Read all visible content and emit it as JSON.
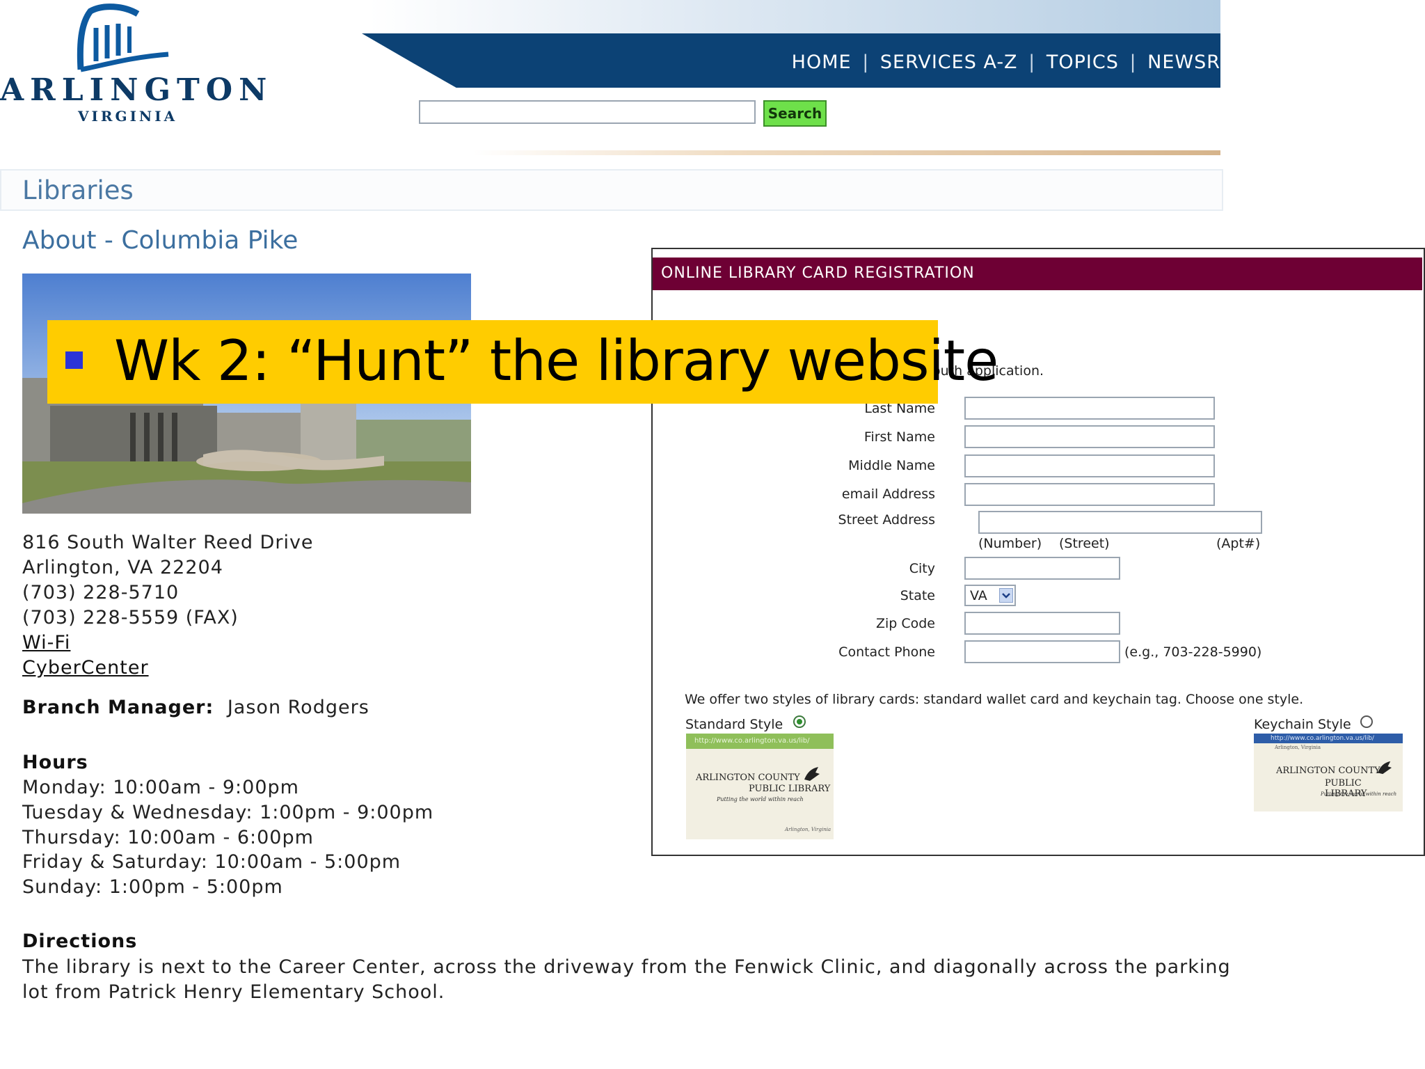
{
  "logo": {
    "name": "ARLINGTON",
    "subtitle": "VIRGINIA"
  },
  "nav": {
    "home": "HOME",
    "services": "SERVICES A-Z",
    "topics": "TOPICS",
    "news": "NEWSR",
    "separator": "|"
  },
  "search": {
    "value": "",
    "button": "Search"
  },
  "section": {
    "title": "Libraries"
  },
  "page": {
    "title": "About - Columbia Pike"
  },
  "branch": {
    "address1": "816 South Walter Reed Drive",
    "address2": "Arlington, VA 22204",
    "phone": "(703) 228-5710",
    "fax": "(703) 228-5559 (FAX)",
    "wifi": "Wi-Fi",
    "cyber": "CyberCenter",
    "manager_label": "Branch Manager:",
    "manager_name": "Jason Rodgers"
  },
  "hours": {
    "title": "Hours",
    "lines": [
      "Monday: 10:00am - 9:00pm",
      "Tuesday & Wednesday: 1:00pm - 9:00pm",
      "Thursday: 10:00am - 6:00pm",
      "Friday & Saturday: 10:00am - 5:00pm",
      "Sunday: 1:00pm - 5:00pm"
    ]
  },
  "directions": {
    "title": "Directions",
    "line1": "The library is next to the Career Center, across the driveway from the Fenwick Clinic, and diagonally across the parking",
    "line2": "lot from Patrick Henry Elementary School."
  },
  "registration": {
    "header": "ONLINE LIBRARY CARD REGISTRATION",
    "intro_fragment": "outh application.",
    "labels": {
      "last": "Last Name",
      "first": "First Name",
      "middle": "Middle Name",
      "email": "email Address",
      "street": "Street Address",
      "city": "City",
      "state": "State",
      "zip": "Zip Code",
      "phone": "Contact Phone"
    },
    "street_hints": {
      "number": "(Number)",
      "street": "(Street)",
      "apt": "(Apt#)"
    },
    "state_value": "VA",
    "phone_hint": "(e.g., 703-228-5990)",
    "card_note": "We offer two styles of library cards: standard wallet card and keychain tag. Choose one style.",
    "standard_label": "Standard Style",
    "keychain_label": "Keychain Style",
    "card_url": "http://www.co.arlington.va.us/lib/",
    "card_org": "Arlington, Virginia",
    "card_name1": "ARLINGTON COUNTY",
    "card_name2": "PUBLIC LIBRARY",
    "card_tagline": "Putting the world within reach"
  },
  "banner": {
    "text": "Wk 2: “Hunt” the library website"
  },
  "colors": {
    "nav": "#0c4275",
    "reg_header": "#6e0034",
    "banner": "#ffcc00",
    "bullet": "#2b34d8"
  }
}
